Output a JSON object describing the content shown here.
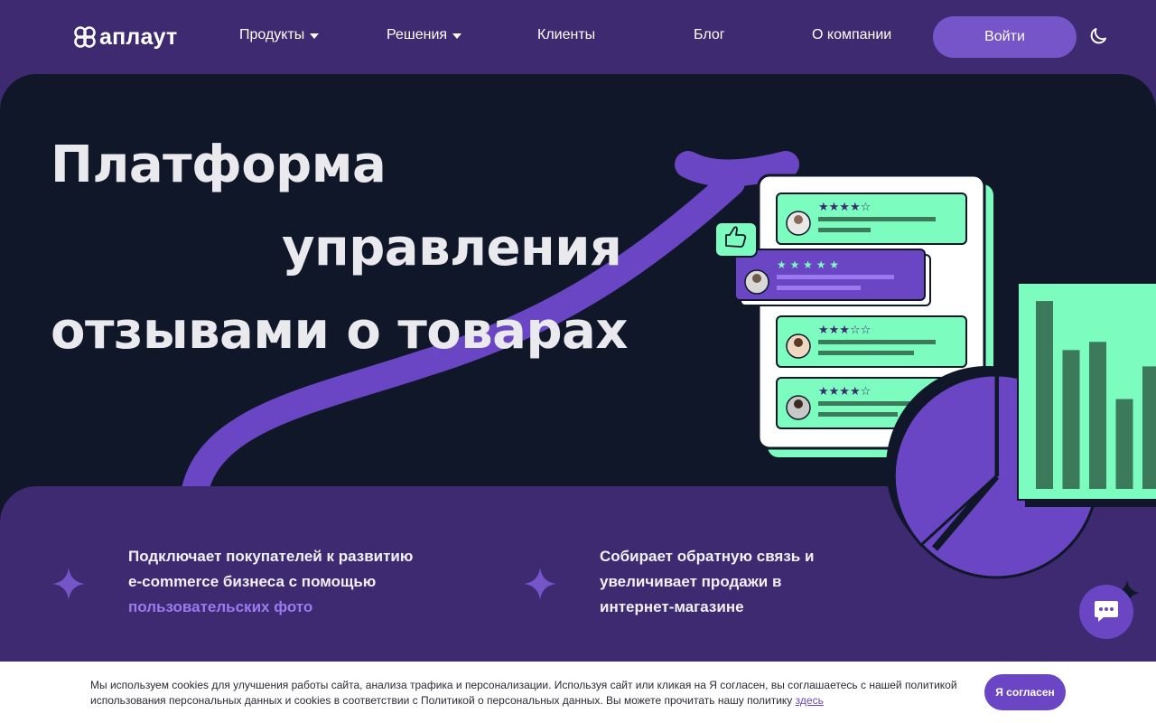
{
  "header": {
    "logo_text": "аплаут",
    "nav": {
      "products": "Продукты",
      "solutions": "Решения",
      "clients": "Клиенты",
      "blog": "Блог",
      "about": "О компании"
    },
    "login_label": "Войти"
  },
  "hero": {
    "title_line1": "Платформа",
    "title_line2": "управления",
    "title_line3": "отзывами о товарах"
  },
  "features": {
    "left_text_1": "Подключает покупателей к развитию",
    "left_text_2": "e-commerce бизнеса с помощью",
    "left_accent": "пользовательских фото",
    "right_text_1": "Собирает обратную связь и",
    "right_text_2": "увеличивает продажи в",
    "right_text_3": "интернет-магазине"
  },
  "reviews": [
    {
      "rating": 4,
      "style": "green"
    },
    {
      "rating": 5,
      "style": "purple"
    },
    {
      "rating": 3,
      "style": "green"
    },
    {
      "rating": 4,
      "style": "green"
    }
  ],
  "bar_chart_levels": [
    0.92,
    0.68,
    0.72,
    0.44,
    0.6
  ],
  "cookie": {
    "text_line1": "Мы используем cookies для улучшения работы сайта, анализа трафика и персонализации. Используя сайт или кликая на Я согласен, вы соглашаетесь с нашей",
    "text_line2": "политикой использования персональных данных и cookies в соответствии с Политикой о персональных данных. Вы можете прочитать нашу политику",
    "link_text": "здесь",
    "agree_label": "Я согласен"
  },
  "colors": {
    "header_bg": "#3d2a70",
    "hero_bg": "#101729",
    "accent_purple": "#6a46c4",
    "mint": "#7dfcc0",
    "dark_green": "#3c7a5c"
  },
  "icons": {
    "logo": "logo-mark-icon",
    "theme": "moon-icon",
    "chat": "chat-bubble-icon",
    "like": "thumbs-up-icon",
    "sparkle": "sparkle-icon"
  }
}
